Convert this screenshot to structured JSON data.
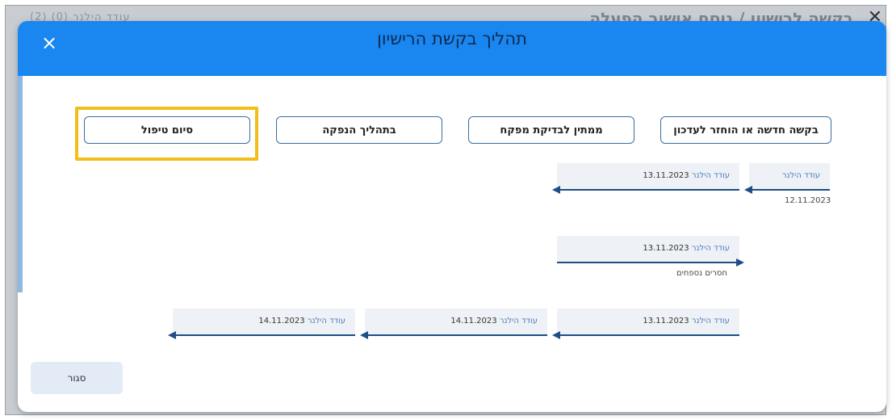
{
  "background": {
    "header_title": "בקשה לרישיון / נוסח אישור הפעלה",
    "tabs_text": "עודד הילנר (0) (2)"
  },
  "modal": {
    "title": "תהליך בקשת הרישיון",
    "close_icon": "×",
    "statuses": [
      {
        "label": "בקשה חדשה או הוחזר לעדכון"
      },
      {
        "label": "ממתין לבדיקת מפקח"
      },
      {
        "label": "בתהליך הנפקה"
      },
      {
        "label": "סיום טיפול"
      }
    ],
    "events": [
      {
        "user": "עודד הילנר",
        "date": "",
        "below": "12.11.2023"
      },
      {
        "user": "עודד הילנר",
        "date": "13.11.2023",
        "below": ""
      },
      {
        "user": "עודד הילנר",
        "date": "13.11.2023",
        "below": "חסרים נספחים"
      },
      {
        "user": "עודד הילנר",
        "date": "13.11.2023",
        "below": ""
      },
      {
        "user": "עודד הילנר",
        "date": "14.11.2023",
        "below": ""
      },
      {
        "user": "עודד הילנר",
        "date": "14.11.2023",
        "below": ""
      }
    ],
    "close_button_label": "סגור"
  },
  "colors": {
    "header": "#1a86f0",
    "highlight": "#f2be1a",
    "arrow": "#1f4e86"
  }
}
